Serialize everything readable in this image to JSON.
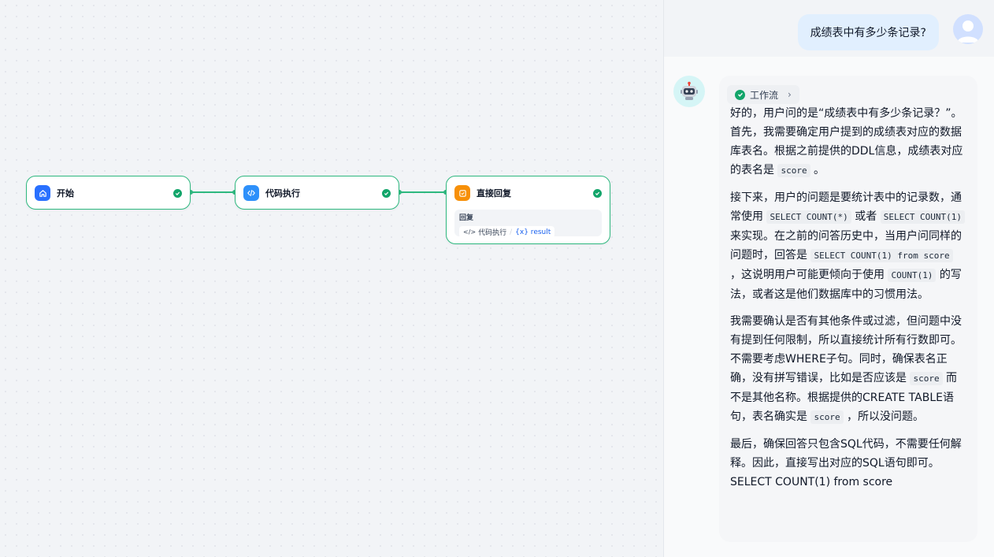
{
  "nodes": {
    "start": {
      "title": "开始",
      "icon": "home-icon",
      "color": "#2970ff"
    },
    "code": {
      "title": "代码执行",
      "icon": "code-icon",
      "color": "#2e90fa"
    },
    "reply": {
      "title": "直接回复",
      "icon": "reply-icon",
      "color": "#f79009",
      "label": "回复",
      "var_node": "代码执行",
      "var_name": "{x} result"
    }
  },
  "colors": {
    "edge": "#2eb87f",
    "success": "#12a56a"
  },
  "chat": {
    "user_message": "成绩表中有多少条记录?",
    "workflow_label": "工作流",
    "p1": {
      "a": "好的，用户问的是“成绩表中有多少条记录？”。首先，我需要确定用户提到的成绩表对应的数据库表名。根据之前提供的DDL信息，成绩表对应的表名是 ",
      "code1": "score",
      "b": " 。"
    },
    "p2": {
      "a": "接下来，用户的问题是要统计表中的记录数，通常使用 ",
      "code1": "SELECT COUNT(*)",
      "b": " 或者 ",
      "code2": "SELECT COUNT(1)",
      "c": " 来实现。在之前的问答历史中，当用户问同样的问题时，回答是 ",
      "code3": "SELECT COUNT(1) from score",
      "d": " ，这说明用户可能更倾向于使用 ",
      "code4": "COUNT(1)",
      "e": " 的写法，或者这是他们数据库中的习惯用法。"
    },
    "p3": {
      "a": "我需要确认是否有其他条件或过滤，但问题中没有提到任何限制，所以直接统计所有行数即可。不需要考虑WHERE子句。同时，确保表名正确，没有拼写错误，比如是否应该是 ",
      "code1": "score",
      "b": " 而不是其他名称。根据提供的CREATE TABLE语句，表名确实是 ",
      "code2": "score",
      "c": " ，所以没问题。"
    },
    "p4": "最后，确保回答只包含SQL代码，不需要任何解释。因此，直接写出对应的SQL语句即可。",
    "p5": "SELECT COUNT(1) from score"
  }
}
